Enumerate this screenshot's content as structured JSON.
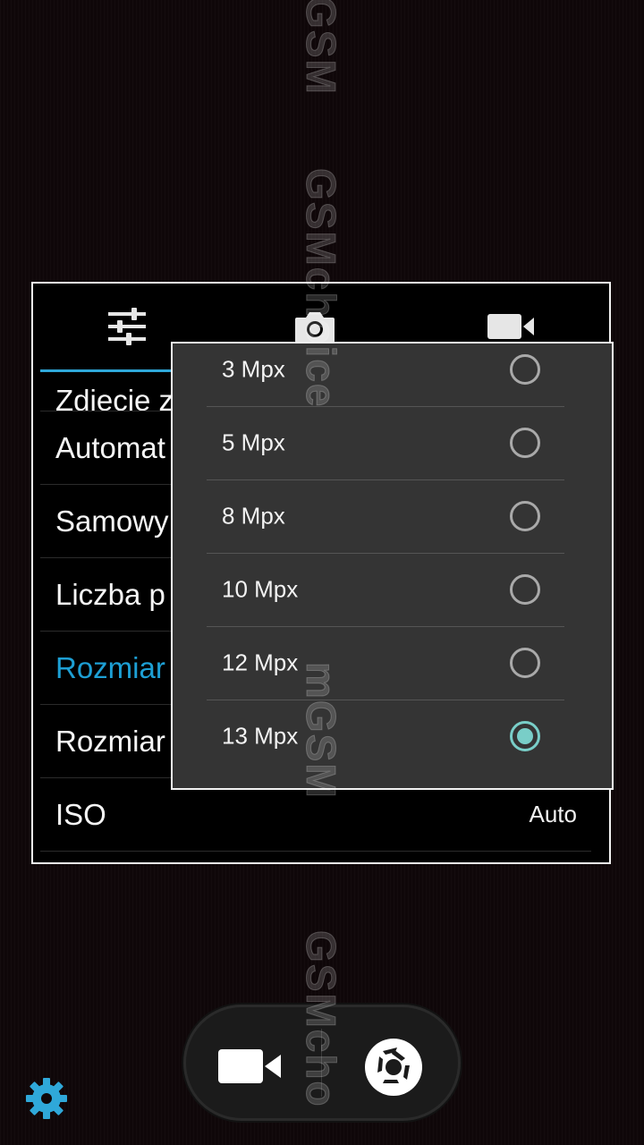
{
  "tabs": [
    {
      "name": "general-settings",
      "icon": "sliders-icon"
    },
    {
      "name": "photo-settings",
      "icon": "camera-icon"
    },
    {
      "name": "video-settings",
      "icon": "video-camera-icon"
    }
  ],
  "settings": [
    {
      "label": "Zdjęcie z",
      "value": ""
    },
    {
      "label": "Automat",
      "value": ""
    },
    {
      "label": "Samowy",
      "value": ""
    },
    {
      "label": "Liczba p",
      "value": ""
    },
    {
      "label": "Rozmiar",
      "value": "",
      "active": true
    },
    {
      "label": "Rozmiar",
      "value": ""
    },
    {
      "label": "ISO",
      "value": "Auto"
    }
  ],
  "resolution_options": [
    {
      "label": "3 Mpx",
      "selected": false
    },
    {
      "label": "5 Mpx",
      "selected": false
    },
    {
      "label": "8 Mpx",
      "selected": false
    },
    {
      "label": "10 Mpx",
      "selected": false
    },
    {
      "label": "12 Mpx",
      "selected": false
    },
    {
      "label": "13 Mpx",
      "selected": true
    }
  ],
  "controls": {
    "video_icon": "video-camera-icon",
    "shutter_icon": "shutter-icon",
    "settings_icon": "gear-icon"
  },
  "watermark": {
    "top": "GSM",
    "middle": "GSMchoice",
    "lower": "mGSM",
    "bottom": "GSMcho"
  },
  "colors": {
    "accent": "#1d9fd4",
    "radio_selected": "#79cec8",
    "gear": "#2fa8d9"
  }
}
